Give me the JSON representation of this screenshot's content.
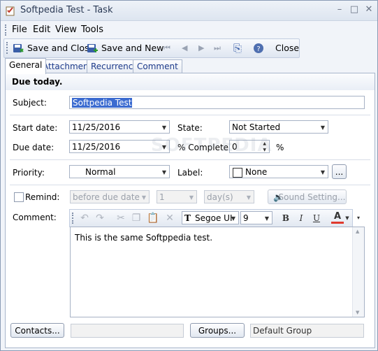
{
  "window": {
    "title": "Softpedia Test - Task"
  },
  "menu": {
    "file": "File",
    "edit": "Edit",
    "view": "View",
    "tools": "Tools"
  },
  "toolbar": {
    "save_close": "Save and Close",
    "save_new": "Save and New",
    "close": "Close"
  },
  "tabs": [
    "General",
    "Attachments",
    "Recurrence",
    "Comment"
  ],
  "form": {
    "due_banner": "Due today.",
    "subject_label": "Subject:",
    "subject_value": "Softpedia Test",
    "start_label": "Start date:",
    "start_value": "11/25/2016",
    "due_label": "Due date:",
    "due_value": "11/25/2016",
    "state_label": "State:",
    "state_value": "Not Started",
    "complete_label": "% Complete:",
    "complete_value": "0",
    "percent_sign": "%",
    "priority_label": "Priority:",
    "priority_value": "Normal",
    "label_label": "Label:",
    "label_value": "None",
    "label_more": "...",
    "remind_label": "Remind:",
    "remind_when": "before due date",
    "remind_count": "1",
    "remind_unit": "day(s)",
    "sound_button": "Sound Setting...",
    "comment_label": "Comment:",
    "font_name": "Segoe UI",
    "font_size": "9",
    "comment_text": "This is the same Softppedia test.",
    "contacts_button": "Contacts...",
    "groups_button": "Groups...",
    "groups_value": "Default Group"
  },
  "watermark": "SOFTPEDIA"
}
